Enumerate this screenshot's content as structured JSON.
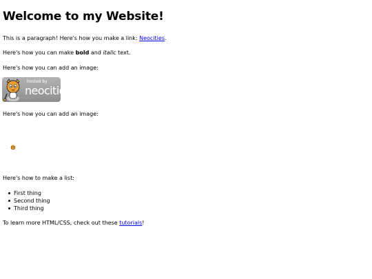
{
  "heading": "Welcome to my Website!",
  "paragraph1": {
    "prefix": "This is a paragraph! Here's how you make a link: ",
    "link_text": "Neocities",
    "suffix": "."
  },
  "paragraph2": {
    "prefix": "Here's how you can make ",
    "bold_text": "bold",
    "middle": " and ",
    "italic_text": "italic",
    "suffix": " text."
  },
  "image_intro_1": "Here's how you can add an image:",
  "badge": {
    "small_text": "hosted by",
    "brand_text": "neocities"
  },
  "image_intro_2": "Here's how you can add an image:",
  "list_intro": "Here's how to make a list:",
  "list_items": [
    "First thing",
    "Second thing",
    "Third thing"
  ],
  "footer": {
    "prefix": "To learn more HTML/CSS, check out these ",
    "link_text": "tutorials",
    "suffix": "!"
  },
  "colors": {
    "link": "#0000ee",
    "badge_bg": "#a5a5a5",
    "cat_orange": "#f0a030"
  }
}
